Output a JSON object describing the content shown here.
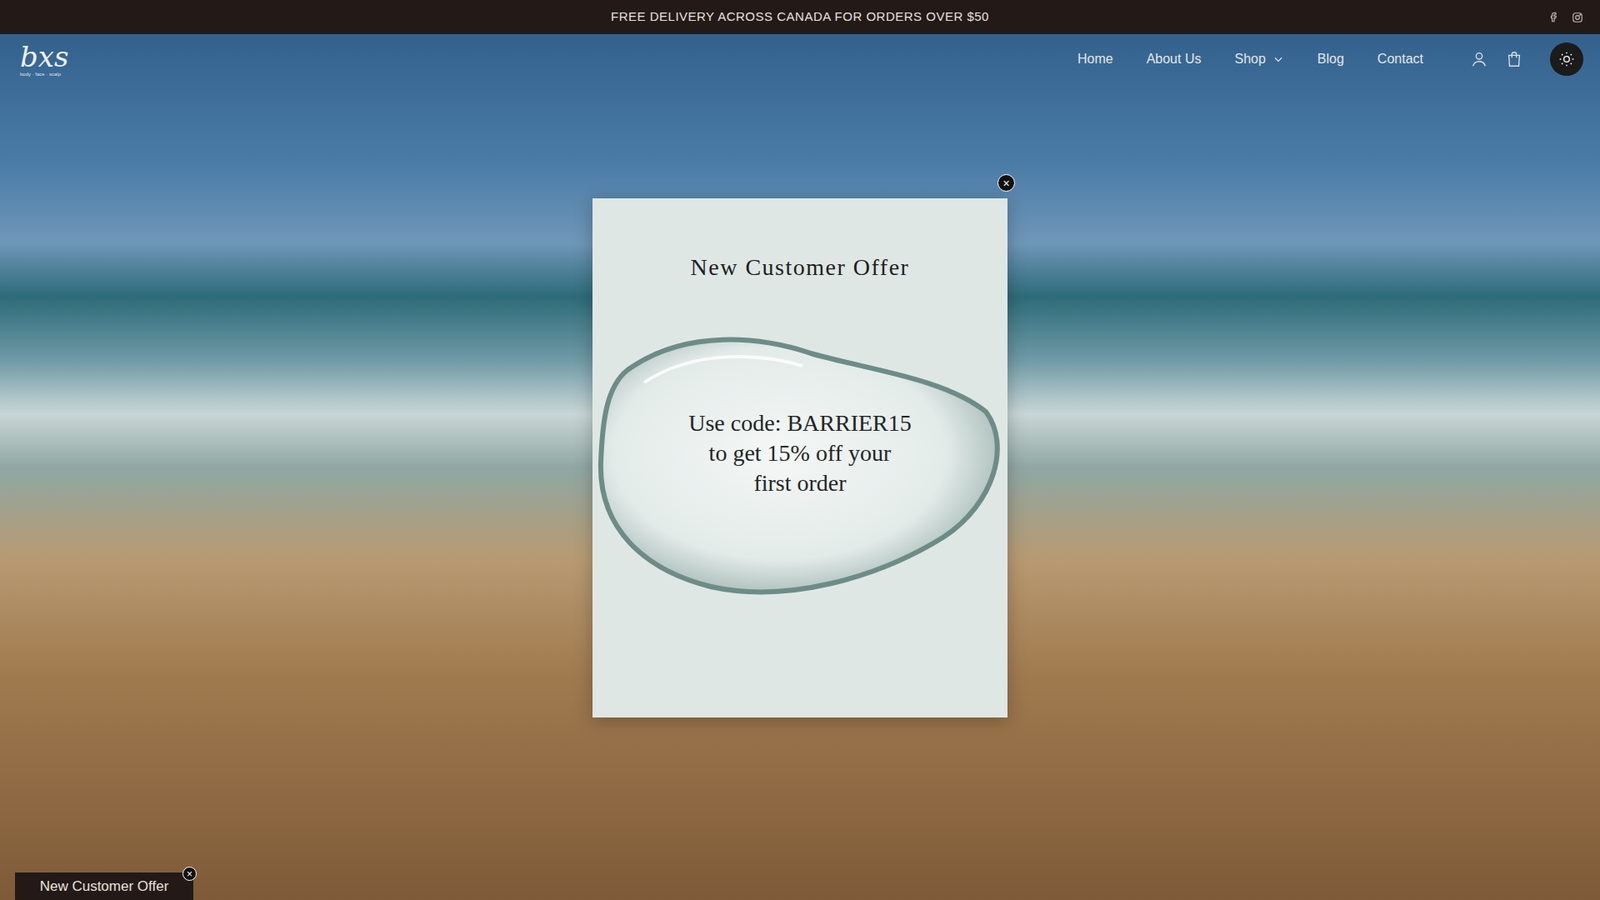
{
  "announcement": "FREE DELIVERY ACROSS CANADA FOR ORDERS OVER $50",
  "logo": {
    "mark": "bxs",
    "tagline": "body · face · scalp"
  },
  "nav": [
    {
      "label": "Home",
      "kind": "link"
    },
    {
      "label": "About Us",
      "kind": "link"
    },
    {
      "label": "Shop",
      "kind": "dropdown"
    },
    {
      "label": "Blog",
      "kind": "link"
    },
    {
      "label": "Contact",
      "kind": "link"
    }
  ],
  "modal": {
    "title": "New Customer Offer",
    "message_lines": [
      "Use code: BARRIER15",
      "to get 15% off your",
      "first order"
    ],
    "close": "×"
  },
  "offer_tab": {
    "label": "New Customer Offer",
    "close": "×"
  }
}
